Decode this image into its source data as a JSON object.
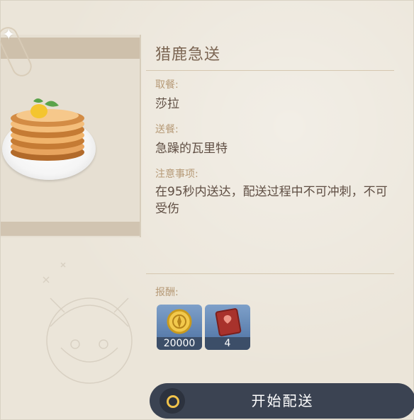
{
  "task": {
    "title": "猎鹿急送",
    "pickup_label": "取餐:",
    "pickup_value": "莎拉",
    "delivery_label": "送餐:",
    "delivery_value": "急躁的瓦里特",
    "notes_label": "注意事项:",
    "notes_text": "在95秒内送达，配送过程中不可冲刺，不可受伤"
  },
  "rewards": {
    "label": "报酬:",
    "items": [
      {
        "icon": "mora-coin-icon",
        "count": "20000"
      },
      {
        "icon": "red-book-icon",
        "count": "4"
      }
    ]
  },
  "action": {
    "start_label": "开始配送",
    "icon": "ring-icon",
    "accent": "#f1c34b"
  },
  "colors": {
    "background": "#ebe5d9",
    "title": "#7b6552",
    "label": "#b69a77",
    "button": "#3b4352"
  }
}
